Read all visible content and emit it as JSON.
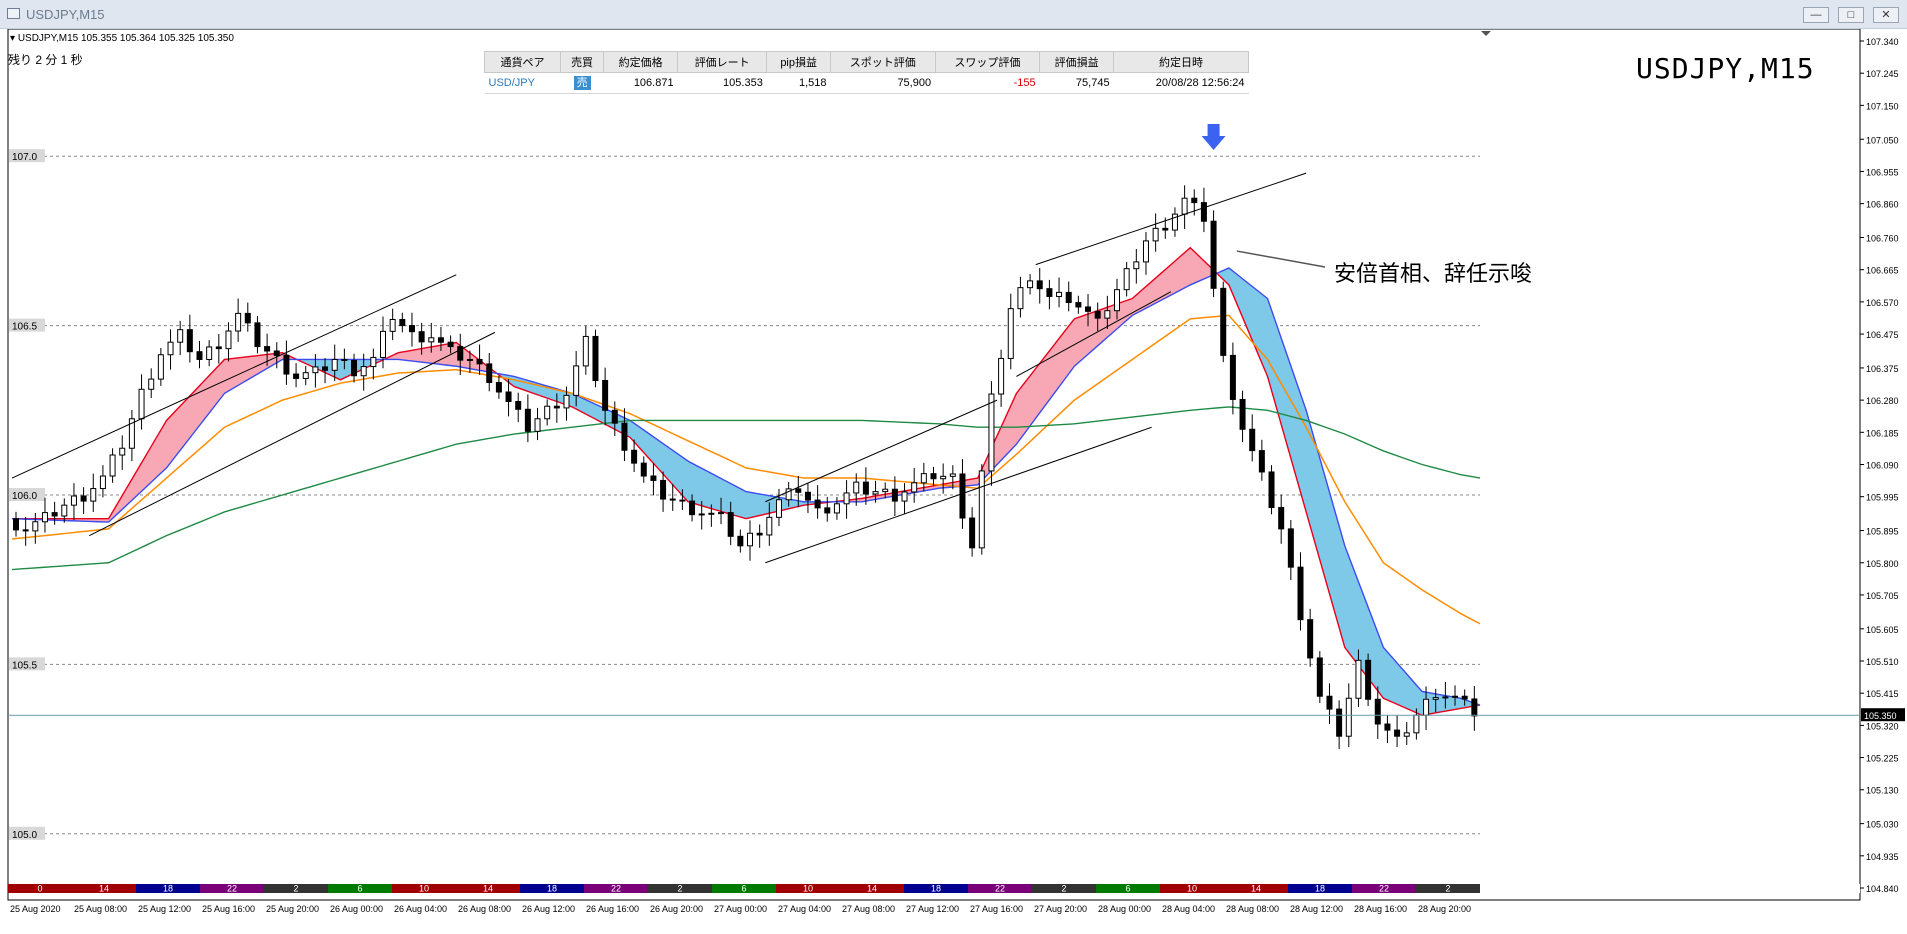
{
  "window": {
    "title": "USDJPY,M15",
    "buttons": [
      "minimize",
      "maximize",
      "close"
    ]
  },
  "chart": {
    "header": "USDJPY,M15  105.355 105.364 105.325 105.350",
    "remaining": "残り 2 分 1 秒",
    "big_title": "USDJPY,M15",
    "annotation": "安倍首相、辞任示唆",
    "current_price_label": "105.350",
    "colors": {
      "candle": "#000000",
      "ma_fast": "#e8001c",
      "ma_mid": "#3b4cf0",
      "ma_slow": "#ff8c00",
      "ma_long": "#1f8a45",
      "cloud_bull": "#f7a8b4",
      "cloud_bear": "#7ec8e8",
      "arrow": "#3b63f0",
      "current_line": "#6a9aa8"
    }
  },
  "positions": {
    "columns": [
      "通貨ペア",
      "売買",
      "約定価格",
      "評価レート",
      "pip損益",
      "スポット評価",
      "スワップ評価",
      "評価損益",
      "約定日時"
    ],
    "rows": [
      {
        "pair": "USD/JPY",
        "side": "売",
        "entry": "106.871",
        "rate": "105.353",
        "pips": "1,518",
        "spot": "75,900",
        "swap": "-155",
        "pnl": "75,745",
        "time": "20/08/28 12:56:24"
      }
    ]
  },
  "session_bar": {
    "labels": [
      {
        "text": "0",
        "color": "#a00000"
      },
      {
        "text": "14",
        "color": "#a00000"
      },
      {
        "text": "18",
        "color": "#000090"
      },
      {
        "text": "22",
        "color": "#7a007a"
      },
      {
        "text": "2",
        "color": "#333333"
      },
      {
        "text": "6",
        "color": "#007a00"
      },
      {
        "text": "10",
        "color": "#a00000"
      },
      {
        "text": "14",
        "color": "#a00000"
      },
      {
        "text": "18",
        "color": "#000090"
      },
      {
        "text": "22",
        "color": "#7a007a"
      },
      {
        "text": "2",
        "color": "#333333"
      },
      {
        "text": "6",
        "color": "#007a00"
      },
      {
        "text": "10",
        "color": "#a00000"
      },
      {
        "text": "14",
        "color": "#a00000"
      },
      {
        "text": "18",
        "color": "#000090"
      },
      {
        "text": "22",
        "color": "#7a007a"
      },
      {
        "text": "2",
        "color": "#333333"
      },
      {
        "text": "6",
        "color": "#007a00"
      },
      {
        "text": "10",
        "color": "#a00000"
      },
      {
        "text": "14",
        "color": "#a00000"
      },
      {
        "text": "18",
        "color": "#000090"
      },
      {
        "text": "22",
        "color": "#7a007a"
      },
      {
        "text": "2",
        "color": "#333333"
      }
    ]
  },
  "chart_data": {
    "type": "candlestick",
    "symbol": "USDJPY,M15",
    "ylim": [
      104.84,
      107.34
    ],
    "y_ticks": [
      "107.340",
      "107.245",
      "107.150",
      "107.050",
      "106.955",
      "106.860",
      "106.760",
      "106.665",
      "106.570",
      "106.475",
      "106.375",
      "106.280",
      "106.185",
      "106.090",
      "105.995",
      "105.895",
      "105.800",
      "105.705",
      "105.605",
      "105.510",
      "105.415",
      "105.320",
      "105.225",
      "105.130",
      "105.030",
      "104.935",
      "104.840"
    ],
    "level_lines": [
      {
        "value": 107.0,
        "label": "107.0"
      },
      {
        "value": 106.5,
        "label": "106.5"
      },
      {
        "value": 106.0,
        "label": "106.0"
      },
      {
        "value": 105.5,
        "label": "105.5"
      },
      {
        "value": 105.0,
        "label": "105.0"
      }
    ],
    "current_price": 105.35,
    "x_labels": [
      "25 Aug 2020",
      "25 Aug 08:00",
      "25 Aug 12:00",
      "25 Aug 16:00",
      "25 Aug 20:00",
      "26 Aug 00:00",
      "26 Aug 04:00",
      "26 Aug 08:00",
      "26 Aug 12:00",
      "26 Aug 16:00",
      "26 Aug 20:00",
      "27 Aug 00:00",
      "27 Aug 04:00",
      "27 Aug 08:00",
      "27 Aug 12:00",
      "27 Aug 16:00",
      "27 Aug 20:00",
      "28 Aug 00:00",
      "28 Aug 04:00",
      "28 Aug 08:00",
      "28 Aug 12:00",
      "28 Aug 16:00",
      "28 Aug 20:00"
    ],
    "close_path": [
      [
        0,
        105.93
      ],
      [
        2,
        105.9
      ],
      [
        4,
        105.93
      ],
      [
        6,
        105.97
      ],
      [
        8,
        106.0
      ],
      [
        10,
        106.05
      ],
      [
        12,
        106.15
      ],
      [
        14,
        106.3
      ],
      [
        16,
        106.42
      ],
      [
        18,
        106.47
      ],
      [
        20,
        106.4
      ],
      [
        22,
        106.45
      ],
      [
        24,
        106.53
      ],
      [
        26,
        106.45
      ],
      [
        28,
        106.4
      ],
      [
        30,
        106.35
      ],
      [
        32,
        106.36
      ],
      [
        34,
        106.4
      ],
      [
        36,
        106.37
      ],
      [
        38,
        106.4
      ],
      [
        40,
        106.53
      ],
      [
        42,
        106.47
      ],
      [
        44,
        106.47
      ],
      [
        46,
        106.42
      ],
      [
        48,
        106.4
      ],
      [
        50,
        106.35
      ],
      [
        52,
        106.27
      ],
      [
        54,
        106.2
      ],
      [
        56,
        106.25
      ],
      [
        58,
        106.3
      ],
      [
        60,
        106.45
      ],
      [
        62,
        106.25
      ],
      [
        64,
        106.15
      ],
      [
        66,
        106.05
      ],
      [
        68,
        106.0
      ],
      [
        70,
        105.97
      ],
      [
        72,
        105.95
      ],
      [
        74,
        105.93
      ],
      [
        76,
        105.85
      ],
      [
        78,
        105.9
      ],
      [
        80,
        105.98
      ],
      [
        82,
        106.02
      ],
      [
        84,
        105.95
      ],
      [
        86,
        105.98
      ],
      [
        88,
        106.02
      ],
      [
        90,
        106.01
      ],
      [
        92,
        106.0
      ],
      [
        94,
        106.03
      ],
      [
        96,
        106.06
      ],
      [
        98,
        106.05
      ],
      [
        100,
        105.85
      ],
      [
        102,
        106.28
      ],
      [
        104,
        106.55
      ],
      [
        106,
        106.65
      ],
      [
        108,
        106.58
      ],
      [
        110,
        106.58
      ],
      [
        112,
        106.53
      ],
      [
        114,
        106.55
      ],
      [
        116,
        106.65
      ],
      [
        118,
        106.75
      ],
      [
        120,
        106.8
      ],
      [
        122,
        106.87
      ],
      [
        124,
        106.82
      ],
      [
        126,
        106.4
      ],
      [
        128,
        106.2
      ],
      [
        130,
        106.05
      ],
      [
        132,
        105.9
      ],
      [
        134,
        105.65
      ],
      [
        136,
        105.4
      ],
      [
        138,
        105.3
      ],
      [
        140,
        105.5
      ],
      [
        142,
        105.33
      ],
      [
        144,
        105.27
      ],
      [
        146,
        105.35
      ],
      [
        148,
        105.42
      ],
      [
        150,
        105.4
      ],
      [
        152,
        105.36
      ]
    ],
    "n_bars": 152,
    "series": [
      {
        "name": "",
        "color": "#e8001c",
        "values": [
          [
            0,
            105.93
          ],
          [
            10,
            105.93
          ],
          [
            16,
            106.22
          ],
          [
            22,
            106.4
          ],
          [
            28,
            106.42
          ],
          [
            34,
            106.34
          ],
          [
            40,
            106.42
          ],
          [
            46,
            106.45
          ],
          [
            52,
            106.32
          ],
          [
            58,
            106.26
          ],
          [
            64,
            106.17
          ],
          [
            70,
            105.98
          ],
          [
            76,
            105.93
          ],
          [
            82,
            105.97
          ],
          [
            88,
            105.99
          ],
          [
            96,
            106.03
          ],
          [
            100,
            106.05
          ],
          [
            104,
            106.3
          ],
          [
            110,
            106.52
          ],
          [
            116,
            106.58
          ],
          [
            122,
            106.73
          ],
          [
            126,
            106.62
          ],
          [
            130,
            106.35
          ],
          [
            134,
            105.95
          ],
          [
            138,
            105.55
          ],
          [
            142,
            105.4
          ],
          [
            146,
            105.35
          ],
          [
            150,
            105.37
          ],
          [
            152,
            105.38
          ]
        ]
      },
      {
        "name": "",
        "color": "#3b4cf0",
        "values": [
          [
            0,
            105.93
          ],
          [
            10,
            105.92
          ],
          [
            16,
            106.08
          ],
          [
            22,
            106.3
          ],
          [
            28,
            106.4
          ],
          [
            34,
            106.4
          ],
          [
            40,
            106.4
          ],
          [
            46,
            106.38
          ],
          [
            52,
            106.35
          ],
          [
            58,
            106.3
          ],
          [
            64,
            106.22
          ],
          [
            70,
            106.1
          ],
          [
            76,
            106.01
          ],
          [
            82,
            105.98
          ],
          [
            88,
            105.98
          ],
          [
            96,
            106.02
          ],
          [
            100,
            106.03
          ],
          [
            104,
            106.15
          ],
          [
            110,
            106.38
          ],
          [
            116,
            106.53
          ],
          [
            122,
            106.62
          ],
          [
            126,
            106.67
          ],
          [
            130,
            106.58
          ],
          [
            134,
            106.25
          ],
          [
            138,
            105.85
          ],
          [
            142,
            105.55
          ],
          [
            146,
            105.42
          ],
          [
            150,
            105.4
          ],
          [
            152,
            105.38
          ]
        ]
      },
      {
        "name": "",
        "color": "#ff8c00",
        "values": [
          [
            0,
            105.87
          ],
          [
            10,
            105.9
          ],
          [
            16,
            106.05
          ],
          [
            22,
            106.2
          ],
          [
            28,
            106.28
          ],
          [
            34,
            106.33
          ],
          [
            40,
            106.36
          ],
          [
            46,
            106.37
          ],
          [
            52,
            106.34
          ],
          [
            58,
            106.3
          ],
          [
            64,
            106.24
          ],
          [
            70,
            106.16
          ],
          [
            76,
            106.08
          ],
          [
            82,
            106.05
          ],
          [
            88,
            106.05
          ],
          [
            96,
            106.03
          ],
          [
            100,
            106.02
          ],
          [
            104,
            106.12
          ],
          [
            110,
            106.28
          ],
          [
            116,
            106.4
          ],
          [
            122,
            106.52
          ],
          [
            126,
            106.53
          ],
          [
            130,
            106.4
          ],
          [
            134,
            106.2
          ],
          [
            138,
            105.98
          ],
          [
            142,
            105.8
          ],
          [
            146,
            105.72
          ],
          [
            150,
            105.65
          ],
          [
            152,
            105.62
          ]
        ]
      },
      {
        "name": "",
        "color": "#1f8a45",
        "values": [
          [
            0,
            105.78
          ],
          [
            10,
            105.8
          ],
          [
            16,
            105.88
          ],
          [
            22,
            105.95
          ],
          [
            28,
            106.0
          ],
          [
            34,
            106.05
          ],
          [
            40,
            106.1
          ],
          [
            46,
            106.15
          ],
          [
            52,
            106.18
          ],
          [
            58,
            106.2
          ],
          [
            64,
            106.22
          ],
          [
            70,
            106.22
          ],
          [
            76,
            106.22
          ],
          [
            82,
            106.22
          ],
          [
            88,
            106.22
          ],
          [
            96,
            106.21
          ],
          [
            100,
            106.2
          ],
          [
            104,
            106.2
          ],
          [
            110,
            106.21
          ],
          [
            116,
            106.23
          ],
          [
            122,
            106.25
          ],
          [
            126,
            106.26
          ],
          [
            130,
            106.25
          ],
          [
            134,
            106.22
          ],
          [
            138,
            106.18
          ],
          [
            142,
            106.13
          ],
          [
            146,
            106.09
          ],
          [
            150,
            106.06
          ],
          [
            152,
            106.05
          ]
        ]
      }
    ]
  }
}
